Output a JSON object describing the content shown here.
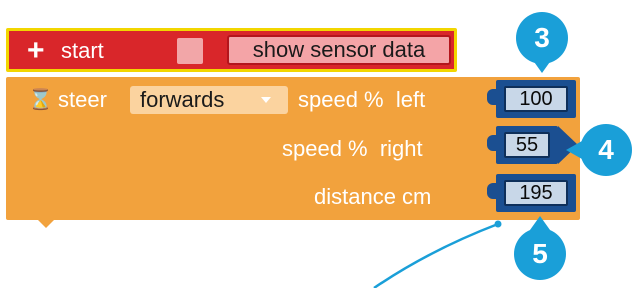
{
  "start_block": {
    "plus_icon": "+",
    "label": "start",
    "sensor_button_label": "show sensor data",
    "color": "#d9262a",
    "highlight_color": "#f2d600"
  },
  "steer_block": {
    "hourglass_icon": "⌛",
    "label": "steer",
    "direction_value": "forwards",
    "speed_left_label": "speed %  left",
    "speed_right_label": "speed %  right",
    "distance_label": "distance cm",
    "color": "#f2a23d",
    "inputs": {
      "speed_left": "100",
      "speed_right": "55",
      "distance": "195"
    }
  },
  "callouts": {
    "badge_3": "3",
    "badge_4": "4",
    "badge_5": "5",
    "color": "#1a9fd8"
  }
}
